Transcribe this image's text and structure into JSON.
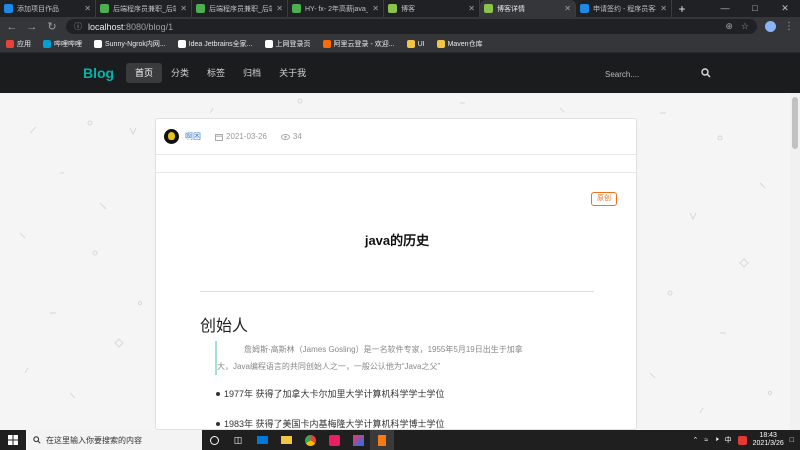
{
  "browser": {
    "tabs": [
      {
        "title": "添加项目作品",
        "favicon_color": "#1e88e5",
        "active": false
      },
      {
        "title": "后端程序员兼职_后端",
        "favicon_color": "#4caf50",
        "active": false
      },
      {
        "title": "后端程序员兼职_后端",
        "favicon_color": "#4caf50",
        "active": false
      },
      {
        "title": "HY- fx- 2年高薪java_互",
        "favicon_color": "#4caf50",
        "active": false
      },
      {
        "title": "博客",
        "favicon_color": "#8bc34a",
        "active": false
      },
      {
        "title": "博客详情",
        "favicon_color": "#8bc34a",
        "active": true
      },
      {
        "title": "申请签约 - 程序员客栈",
        "favicon_color": "#1e88e5",
        "active": false
      }
    ],
    "new_tab_label": "+",
    "url_host": "localhost",
    "url_path": ":8080/blog/1",
    "bookmarks": [
      {
        "label": "应用",
        "color": "#ea4335"
      },
      {
        "label": "哔哩哔哩",
        "color": "#00a1d6"
      },
      {
        "label": "Sunny-Ngrok内网...",
        "color": "#ffffff"
      },
      {
        "label": "Idea Jetbrains全家...",
        "color": "#ffffff"
      },
      {
        "label": "上网登录页",
        "color": "#ffffff"
      },
      {
        "label": "阿里云登录 - 欢迎...",
        "color": "#ff6a00"
      },
      {
        "label": "UI",
        "color": "#f4c542"
      },
      {
        "label": "Maven仓库",
        "color": "#f4c542"
      }
    ]
  },
  "site": {
    "logo": "Blog",
    "nav": [
      "首页",
      "分类",
      "标签",
      "归档",
      "关于我"
    ],
    "active_nav": 0,
    "search_placeholder": "Search....",
    "accent": "#00b5ad"
  },
  "post": {
    "author": "啊困",
    "date": "2021-03-26",
    "views": "34",
    "badge": "原创",
    "title": "java的历史",
    "heading": "创始人",
    "quote_line1": "詹姆斯·高斯林（James Gosling）是一名软件专家，1955年5月19日出生于加拿",
    "quote_line2": "大，Java编程语言的共同创始人之一，一般公认他为“Java之父”",
    "list": [
      "1977年 获得了加拿大卡尔加里大学计算机科学学士学位",
      "1983年 获得了美国卡内基梅隆大学计算机科学博士学位"
    ]
  },
  "taskbar": {
    "search_placeholder": "在这里输入你要搜索的内容",
    "time": "18:43",
    "date": "2021/3/26",
    "ime": "中"
  }
}
